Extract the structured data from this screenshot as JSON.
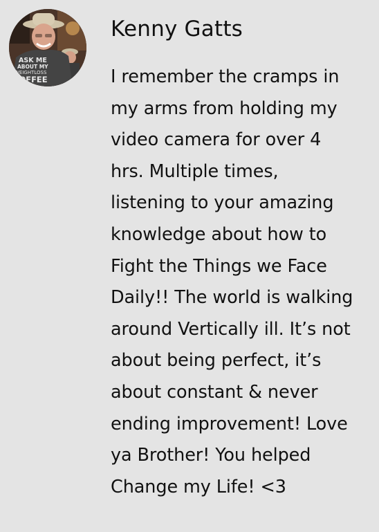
{
  "comment": {
    "author": {
      "name": "Kenny Gatts",
      "avatar_icon": "user-avatar-photo",
      "avatar_shirt_text": [
        "ASK ME",
        "ABOUT MY",
        "WEIGHTLOSS",
        "COFFEE"
      ]
    },
    "body_lines": [
      "I remember the cramps in",
      "my arms from holding my",
      "video camera for over 4",
      "hrs. Multiple times,",
      "listening to your amazing",
      "knowledge about how to",
      "Fight the Things we Face",
      "Daily!! The world is walking",
      "around Vertically ill. It’s not",
      "about being perfect, it’s",
      "about constant & never",
      "ending improvement! Love",
      "ya Brother! You helped",
      "Change my Life! <3"
    ]
  },
  "colors": {
    "background": "#e4e4e4",
    "text": "#111111"
  }
}
